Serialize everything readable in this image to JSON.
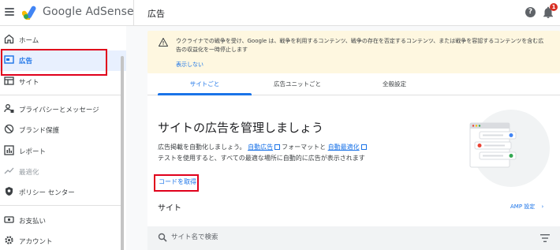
{
  "app": {
    "brand": "Google AdSense",
    "page_title": "広告",
    "notification_count": "1",
    "help_glyph": "?"
  },
  "sidebar": {
    "items": [
      {
        "label": "ホーム",
        "icon": "home-icon"
      },
      {
        "label": "広告",
        "icon": "ads-icon",
        "active": true
      },
      {
        "label": "サイト",
        "icon": "sites-icon"
      },
      {
        "label": "プライバシーとメッセージ",
        "icon": "privacy-icon"
      },
      {
        "label": "ブランド保護",
        "icon": "block-icon"
      },
      {
        "label": "レポート",
        "icon": "reports-icon"
      },
      {
        "label": "最適化",
        "icon": "trend-icon",
        "disabled": true
      },
      {
        "label": "ポリシー センター",
        "icon": "shield-icon"
      },
      {
        "label": "お支払い",
        "icon": "payments-icon"
      },
      {
        "label": "アカウント",
        "icon": "gear-icon"
      }
    ]
  },
  "banner": {
    "text": "ウクライナでの戦争を受け、Google は、戦争を利用するコンテンツ、戦争の存在を否定するコンテンツ、または戦争を容認するコンテンツを含む広告の収益化を一時停止します",
    "dismiss": "表示しない"
  },
  "tabs": [
    "サイトごと",
    "広告ユニットごと",
    "全般設定"
  ],
  "hero": {
    "title": "サイトの広告を管理しましょう",
    "line1_pre": "広告掲載を自動化しましょう。",
    "auto_ads": "自動広告",
    "line1_mid": "フォーマットと",
    "auto_opt": "自動最適化",
    "line2": "テストを使用すると、すべての最適な場所に自動的に広告が表示されます",
    "get_code": "コードを取得"
  },
  "sites": {
    "heading": "サイト",
    "amp": "AMP 設定",
    "search_placeholder": "サイト名で検索"
  },
  "colors": {
    "accent": "#1a73e8",
    "highlight_box": "#e0001b",
    "banner_bg": "#fef7e0",
    "active_bg": "#e8f0fe"
  }
}
